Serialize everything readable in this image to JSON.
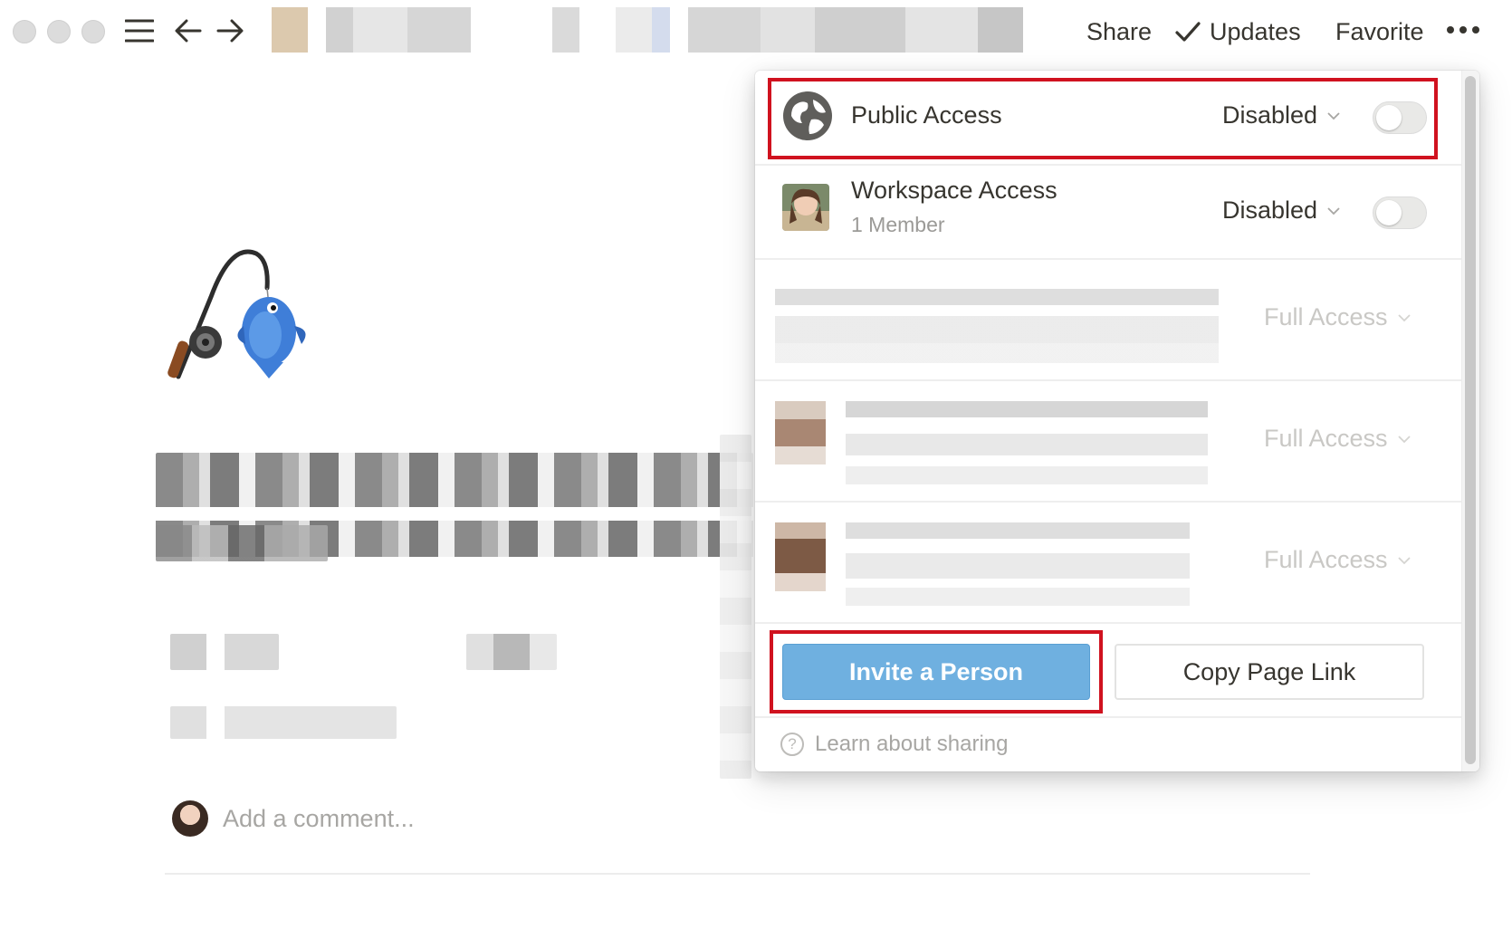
{
  "topbar": {
    "share_label": "Share",
    "updates_label": "Updates",
    "favorite_label": "Favorite"
  },
  "page": {
    "comment_placeholder": "Add a comment..."
  },
  "share_menu": {
    "public_access": {
      "title": "Public Access",
      "status": "Disabled",
      "enabled": false
    },
    "workspace_access": {
      "title": "Workspace Access",
      "subtitle": "1 Member",
      "status": "Disabled",
      "enabled": false
    },
    "members": [
      {
        "access": "Full Access"
      },
      {
        "access": "Full Access"
      },
      {
        "access": "Full Access"
      }
    ],
    "invite_button": "Invite a Person",
    "copy_link_button": "Copy Page Link",
    "learn_link": "Learn about sharing"
  },
  "colors": {
    "accent": "#6fb0e0",
    "highlight": "#d0121f",
    "text": "#37352f",
    "muted": "#a7a6a3"
  }
}
